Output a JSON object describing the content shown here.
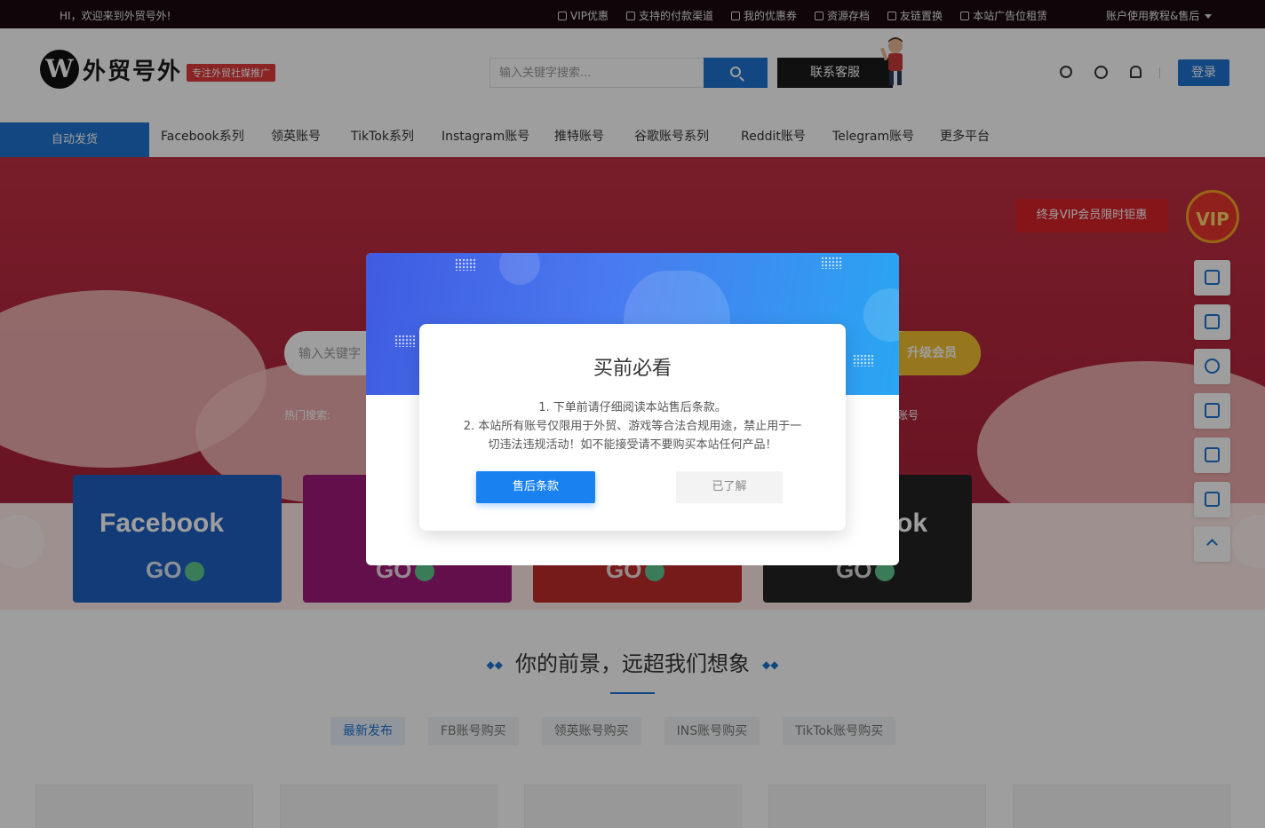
{
  "topbar": {
    "welcome": "HI，欢迎来到外贸号外!",
    "links": [
      "VIP优惠",
      "支持的付款渠道",
      "我的优惠券",
      "资源存档",
      "友链置换",
      "本站广告位租赁"
    ],
    "account_menu": "账户使用教程&售后"
  },
  "header": {
    "logo_letter": "W",
    "logo_text": "外贸号外",
    "logo_tag": "专注外贸社媒推广",
    "search_placeholder": "输入关键字搜索...",
    "contact_label": "联系客服",
    "login_label": "登录"
  },
  "nav": {
    "items": [
      "自动发货",
      "Facebook系列",
      "领英账号",
      "TikTok系列",
      "Instagram账号",
      "推特账号",
      "谷歌账号系列",
      "Reddit账号",
      "Telegram账号",
      "更多平台"
    ]
  },
  "banner": {
    "vip_tag": "终身VIP会员限时钜惠",
    "vip_badge": "VIP",
    "search_placeholder": "输入关键字",
    "upgrade_label": "升级会员",
    "hot_label": "热门搜索:",
    "hot_right": "账号",
    "cards": [
      {
        "title": "Facebook",
        "go": "GO",
        "color": "#1d5fc0"
      },
      {
        "title": "",
        "go": "GO",
        "color": "#a0197a"
      },
      {
        "title": "",
        "go": "GO",
        "color": "#c12a2a"
      },
      {
        "title": "ok",
        "go": "GO",
        "color": "#222222"
      }
    ]
  },
  "section": {
    "title": "你的前景，远超我们想象",
    "tabs": [
      "最新发布",
      "FB账号购买",
      "领英账号购买",
      "INS账号购买",
      "TikTok账号购买"
    ]
  },
  "modal": {
    "title": "买前必看",
    "line1": "1. 下单前请仔细阅读本站售后条款。",
    "line2": "2. 本站所有账号仅限用于外贸、游戏等合法合规用途，禁止用于一",
    "line3": "切违法违规活动！如不能接受请不要购买本站任何产品！",
    "primary_button": "售后条款",
    "secondary_button": "已了解"
  },
  "colors": {
    "accent": "#1e73d0",
    "banner_red": "#b5273e",
    "modal_primary": "#1a82f0"
  },
  "float_icons": [
    "headset-icon",
    "edit-icon",
    "telegram-icon",
    "cart-icon",
    "wallet-icon",
    "mail-icon",
    "arrow-up-icon"
  ]
}
